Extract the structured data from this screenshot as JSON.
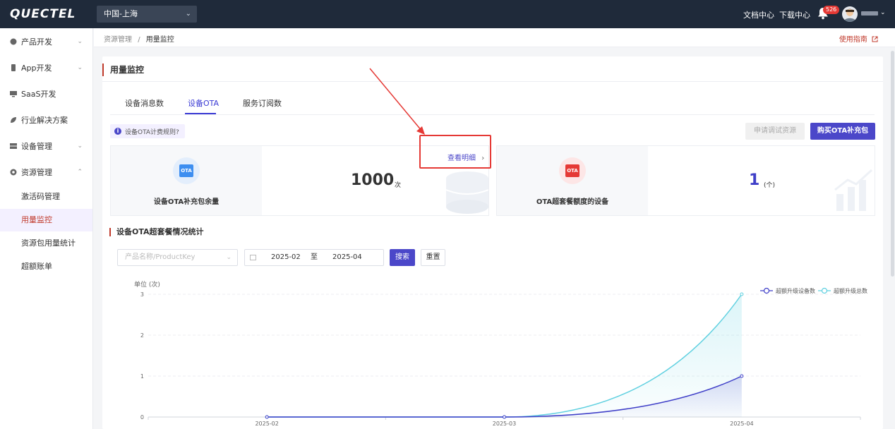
{
  "brand": {
    "logo": "QUECTEL"
  },
  "header": {
    "region": "中国-上海",
    "docs": "文档中心",
    "downloads": "下载中心",
    "notifications": "526"
  },
  "sidebar": {
    "items": [
      {
        "label": "产品开发",
        "icon": "box-icon"
      },
      {
        "label": "App开发",
        "icon": "mobile-icon"
      },
      {
        "label": "SaaS开发",
        "icon": "monitor-icon"
      },
      {
        "label": "行业解决方案",
        "icon": "leaf-icon"
      },
      {
        "label": "设备管理",
        "icon": "device-icon"
      },
      {
        "label": "资源管理",
        "icon": "resource-icon"
      }
    ],
    "sub_items": [
      "激活码管理",
      "用量监控",
      "资源包用量统计",
      "超额账单"
    ]
  },
  "breadcrumb": {
    "parent": "资源管理",
    "sep": "/",
    "current": "用量监控"
  },
  "guide": "使用指南",
  "page_title": "用量监控",
  "tabs": [
    "设备消息数",
    "设备OTA",
    "服务订阅数"
  ],
  "rule_link": "设备OTA计费规则?",
  "buttons": {
    "trial": "申请调试资源",
    "buy": "购买OTA补充包",
    "view": "查看明细",
    "search": "搜索",
    "reset": "重置"
  },
  "stats": [
    {
      "icon_text": "OTA",
      "label": "设备OTA补充包余量",
      "value": "1000",
      "unit": "次"
    },
    {
      "icon_text": "OTA",
      "label": "OTA超套餐额度的设备",
      "value": "1",
      "unit": "(个)"
    }
  ],
  "section_title": "设备OTA超套餐情况统计",
  "filter": {
    "product_placeholder": "产品名称/ProductKey",
    "start": "2025-02",
    "to": "至",
    "end": "2025-04"
  },
  "colors": {
    "accent": "#4b47c9",
    "brand_red": "#c0392b",
    "series1": "#3f3fc8",
    "series2": "#5fd0e0"
  },
  "chart_data": {
    "type": "line",
    "ylabel": "单位 (次)",
    "categories": [
      "2025-02",
      "2025-03",
      "2025-04"
    ],
    "yticks": [
      0,
      1,
      2,
      3
    ],
    "ylim": [
      0,
      3
    ],
    "legend_position": "top-right",
    "series": [
      {
        "name": "超额升级设备数",
        "values": [
          0,
          0,
          1
        ]
      },
      {
        "name": "超额升级总数",
        "values": [
          0,
          0,
          3
        ]
      }
    ]
  }
}
